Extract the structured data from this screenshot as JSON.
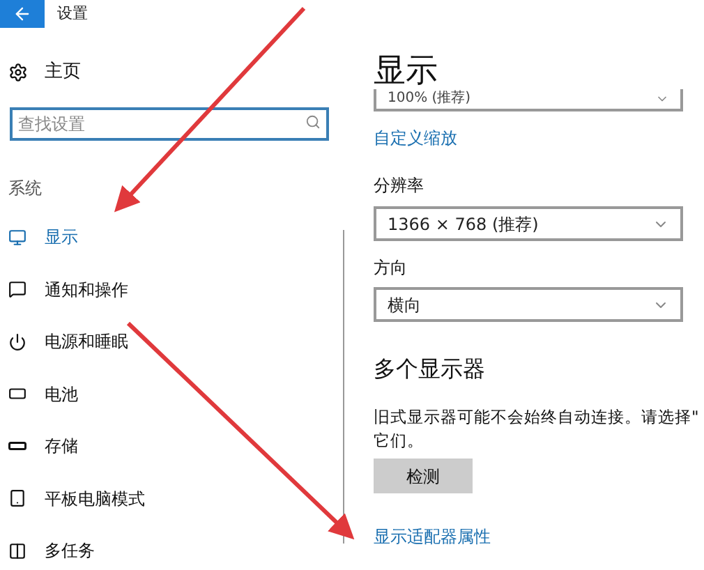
{
  "window": {
    "title": "设置"
  },
  "sidebar": {
    "home": "主页",
    "search": {
      "placeholder": "查找设置"
    },
    "group": "系统",
    "items": [
      {
        "label": "显示",
        "selected": true
      },
      {
        "label": "通知和操作",
        "selected": false
      },
      {
        "label": "电源和睡眠",
        "selected": false
      },
      {
        "label": "电池",
        "selected": false
      },
      {
        "label": "存储",
        "selected": false
      },
      {
        "label": "平板电脑模式",
        "selected": false
      },
      {
        "label": "多任务",
        "selected": false
      }
    ]
  },
  "content": {
    "title": "显示",
    "scale_dropdown": "100% (推荐)",
    "custom_scale_link": "自定义缩放",
    "resolution": {
      "label": "分辨率",
      "value": "1366 × 768 (推荐)"
    },
    "orientation": {
      "label": "方向",
      "value": "横向"
    },
    "multiple_displays": {
      "title": "多个显示器",
      "text_lines": [
        "旧式显示器可能不会始终自动连接。请选择\"",
        "它们。"
      ],
      "button": "检测"
    },
    "adapter_link": "显示适配器属性"
  }
}
